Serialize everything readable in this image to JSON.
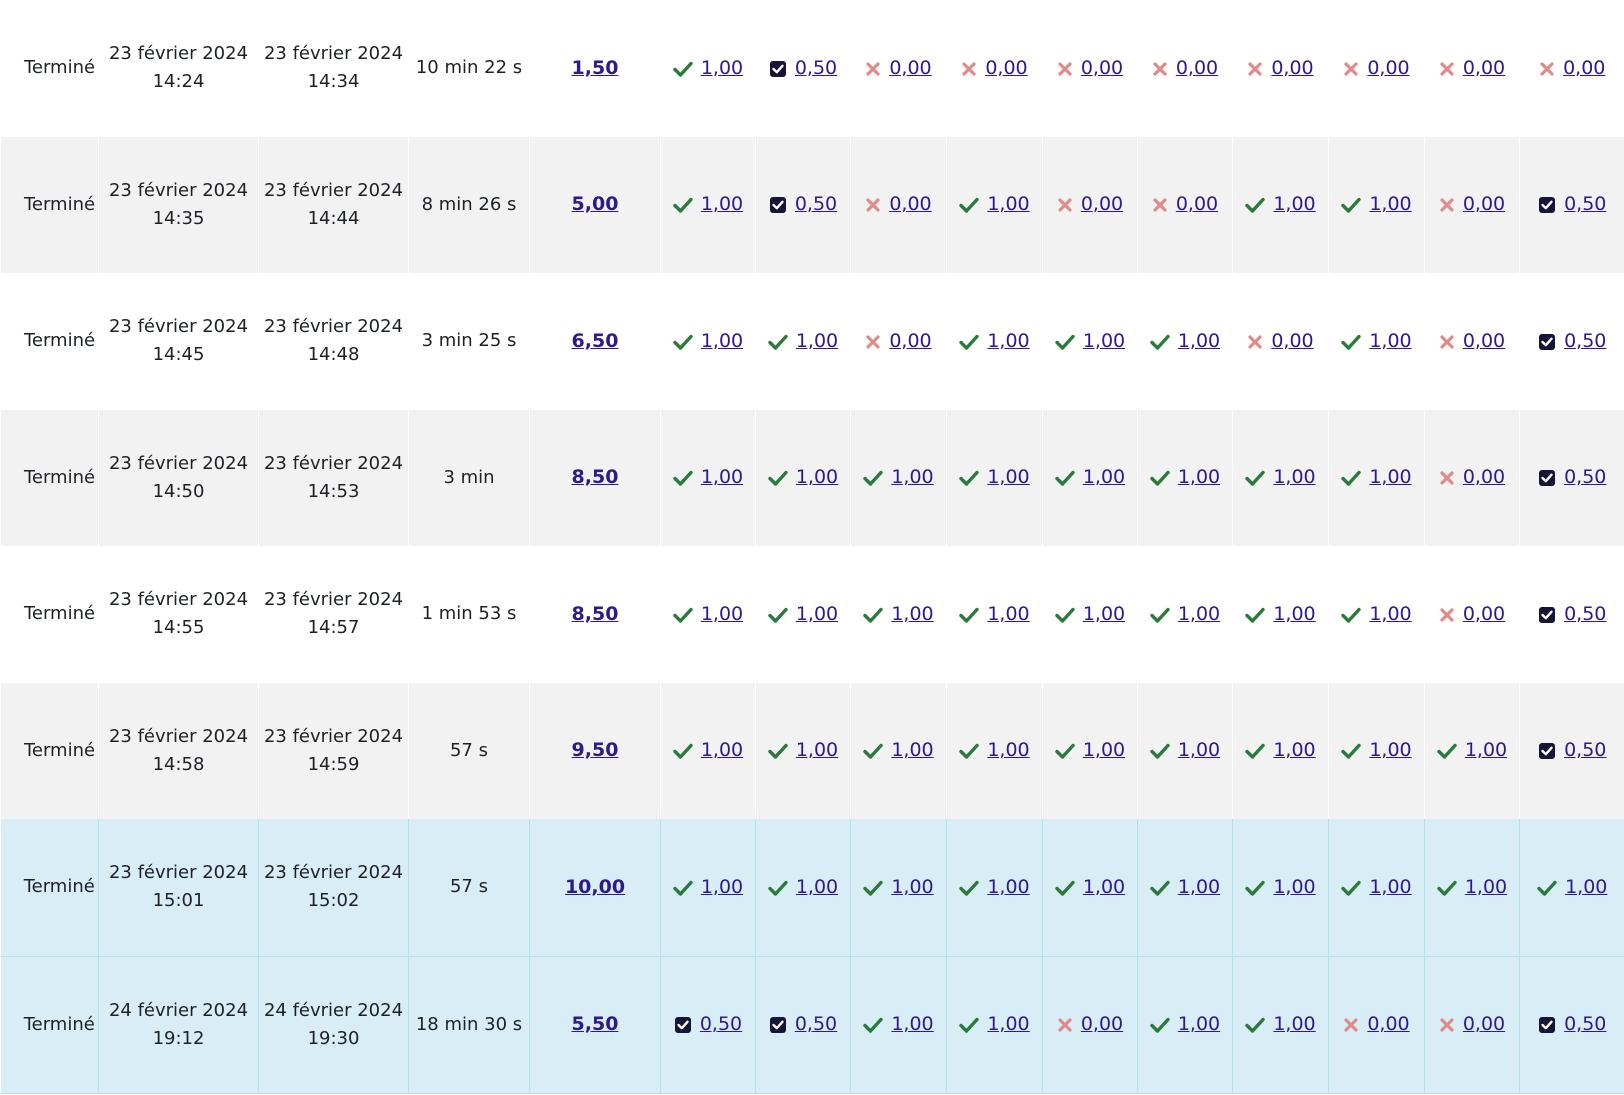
{
  "colors": {
    "correct": "#2a7b3a",
    "incorrect": "#e08a8a",
    "partial": "#151537",
    "link": "#2e1a8c",
    "highlight_row": "#d9edf7",
    "striped_row": "#f2f2f2"
  },
  "rows": [
    {
      "state": "Terminé",
      "start_date": "23 février 2024",
      "start_time": "14:24",
      "end_date": "23 février 2024",
      "end_time": "14:34",
      "duration": "10 min 22 s",
      "grade": "1,50",
      "questions": [
        {
          "s": "correct",
          "m": "1,00"
        },
        {
          "s": "partial",
          "m": "0,50"
        },
        {
          "s": "incorrect",
          "m": "0,00"
        },
        {
          "s": "incorrect",
          "m": "0,00"
        },
        {
          "s": "incorrect",
          "m": "0,00"
        },
        {
          "s": "incorrect",
          "m": "0,00"
        },
        {
          "s": "incorrect",
          "m": "0,00"
        },
        {
          "s": "incorrect",
          "m": "0,00"
        },
        {
          "s": "incorrect",
          "m": "0,00"
        },
        {
          "s": "incorrect",
          "m": "0,00"
        }
      ]
    },
    {
      "state": "Terminé",
      "start_date": "23 février 2024",
      "start_time": "14:35",
      "end_date": "23 février 2024",
      "end_time": "14:44",
      "duration": "8 min 26 s",
      "grade": "5,00",
      "questions": [
        {
          "s": "correct",
          "m": "1,00"
        },
        {
          "s": "partial",
          "m": "0,50"
        },
        {
          "s": "incorrect",
          "m": "0,00"
        },
        {
          "s": "correct",
          "m": "1,00"
        },
        {
          "s": "incorrect",
          "m": "0,00"
        },
        {
          "s": "incorrect",
          "m": "0,00"
        },
        {
          "s": "correct",
          "m": "1,00"
        },
        {
          "s": "correct",
          "m": "1,00"
        },
        {
          "s": "incorrect",
          "m": "0,00"
        },
        {
          "s": "partial",
          "m": "0,50"
        }
      ]
    },
    {
      "state": "Terminé",
      "start_date": "23 février 2024",
      "start_time": "14:45",
      "end_date": "23 février 2024",
      "end_time": "14:48",
      "duration": "3 min 25 s",
      "grade": "6,50",
      "questions": [
        {
          "s": "correct",
          "m": "1,00"
        },
        {
          "s": "correct",
          "m": "1,00"
        },
        {
          "s": "incorrect",
          "m": "0,00"
        },
        {
          "s": "correct",
          "m": "1,00"
        },
        {
          "s": "correct",
          "m": "1,00"
        },
        {
          "s": "correct",
          "m": "1,00"
        },
        {
          "s": "incorrect",
          "m": "0,00"
        },
        {
          "s": "correct",
          "m": "1,00"
        },
        {
          "s": "incorrect",
          "m": "0,00"
        },
        {
          "s": "partial",
          "m": "0,50"
        }
      ]
    },
    {
      "state": "Terminé",
      "start_date": "23 février 2024",
      "start_time": "14:50",
      "end_date": "23 février 2024",
      "end_time": "14:53",
      "duration": "3 min",
      "grade": "8,50",
      "questions": [
        {
          "s": "correct",
          "m": "1,00"
        },
        {
          "s": "correct",
          "m": "1,00"
        },
        {
          "s": "correct",
          "m": "1,00"
        },
        {
          "s": "correct",
          "m": "1,00"
        },
        {
          "s": "correct",
          "m": "1,00"
        },
        {
          "s": "correct",
          "m": "1,00"
        },
        {
          "s": "correct",
          "m": "1,00"
        },
        {
          "s": "correct",
          "m": "1,00"
        },
        {
          "s": "incorrect",
          "m": "0,00"
        },
        {
          "s": "partial",
          "m": "0,50"
        }
      ]
    },
    {
      "state": "Terminé",
      "start_date": "23 février 2024",
      "start_time": "14:55",
      "end_date": "23 février 2024",
      "end_time": "14:57",
      "duration": "1 min 53 s",
      "grade": "8,50",
      "questions": [
        {
          "s": "correct",
          "m": "1,00"
        },
        {
          "s": "correct",
          "m": "1,00"
        },
        {
          "s": "correct",
          "m": "1,00"
        },
        {
          "s": "correct",
          "m": "1,00"
        },
        {
          "s": "correct",
          "m": "1,00"
        },
        {
          "s": "correct",
          "m": "1,00"
        },
        {
          "s": "correct",
          "m": "1,00"
        },
        {
          "s": "correct",
          "m": "1,00"
        },
        {
          "s": "incorrect",
          "m": "0,00"
        },
        {
          "s": "partial",
          "m": "0,50"
        }
      ]
    },
    {
      "state": "Terminé",
      "start_date": "23 février 2024",
      "start_time": "14:58",
      "end_date": "23 février 2024",
      "end_time": "14:59",
      "duration": "57 s",
      "grade": "9,50",
      "questions": [
        {
          "s": "correct",
          "m": "1,00"
        },
        {
          "s": "correct",
          "m": "1,00"
        },
        {
          "s": "correct",
          "m": "1,00"
        },
        {
          "s": "correct",
          "m": "1,00"
        },
        {
          "s": "correct",
          "m": "1,00"
        },
        {
          "s": "correct",
          "m": "1,00"
        },
        {
          "s": "correct",
          "m": "1,00"
        },
        {
          "s": "correct",
          "m": "1,00"
        },
        {
          "s": "correct",
          "m": "1,00"
        },
        {
          "s": "partial",
          "m": "0,50"
        }
      ]
    },
    {
      "state": "Terminé",
      "start_date": "23 février 2024",
      "start_time": "15:01",
      "end_date": "23 février 2024",
      "end_time": "15:02",
      "duration": "57 s",
      "grade": "10,00",
      "highlight": true,
      "questions": [
        {
          "s": "correct",
          "m": "1,00"
        },
        {
          "s": "correct",
          "m": "1,00"
        },
        {
          "s": "correct",
          "m": "1,00"
        },
        {
          "s": "correct",
          "m": "1,00"
        },
        {
          "s": "correct",
          "m": "1,00"
        },
        {
          "s": "correct",
          "m": "1,00"
        },
        {
          "s": "correct",
          "m": "1,00"
        },
        {
          "s": "correct",
          "m": "1,00"
        },
        {
          "s": "correct",
          "m": "1,00"
        },
        {
          "s": "correct",
          "m": "1,00"
        }
      ]
    },
    {
      "state": "Terminé",
      "start_date": "24 février 2024",
      "start_time": "19:12",
      "end_date": "24 février 2024",
      "end_time": "19:30",
      "duration": "18 min 30 s",
      "grade": "5,50",
      "highlight": true,
      "questions": [
        {
          "s": "partial",
          "m": "0,50"
        },
        {
          "s": "partial",
          "m": "0,50"
        },
        {
          "s": "correct",
          "m": "1,00"
        },
        {
          "s": "correct",
          "m": "1,00"
        },
        {
          "s": "incorrect",
          "m": "0,00"
        },
        {
          "s": "correct",
          "m": "1,00"
        },
        {
          "s": "correct",
          "m": "1,00"
        },
        {
          "s": "incorrect",
          "m": "0,00"
        },
        {
          "s": "incorrect",
          "m": "0,00"
        },
        {
          "s": "partial",
          "m": "0,50"
        }
      ]
    }
  ]
}
